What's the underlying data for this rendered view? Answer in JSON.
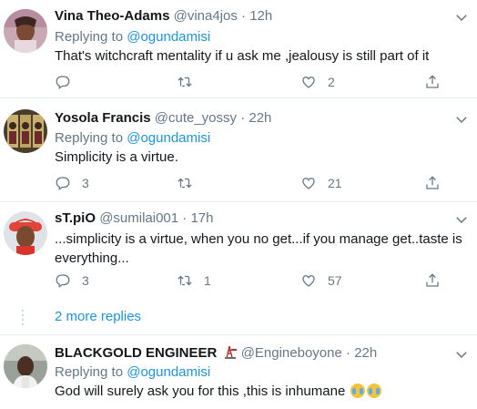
{
  "tweets": [
    {
      "name": "Vina Theo-Adams",
      "handle": "@vina4jos",
      "separator": "·",
      "time": "12h",
      "replying_prefix": "Replying to",
      "replying_to": "@ogundamisi",
      "text": "That's witchcraft mentality if u ask me ,jealousy is still part of it",
      "replies": "",
      "retweets": "",
      "likes": "2"
    },
    {
      "name": "Yosola Francis",
      "handle": "@cute_yossy",
      "separator": "·",
      "time": "22h",
      "replying_prefix": "Replying to",
      "replying_to": "@ogundamisi",
      "text": "Simplicity is a virtue.",
      "replies": "3",
      "retweets": "",
      "likes": "21"
    },
    {
      "name": "sT.piO",
      "handle": "@sumilai001",
      "separator": "·",
      "time": "17h",
      "text": "...simplicity is a virtue, when you no get...if you manage get..taste is everything...",
      "replies": "3",
      "retweets": "1",
      "likes": "57"
    },
    {
      "name": "BLACKGOLD ENGINEER",
      "handle": "@Engineboyone",
      "separator": "·",
      "time": "22h",
      "replying_prefix": "Replying to",
      "replying_to": "@ogundamisi",
      "text": "God will surely ask you for this ,this is inhumane"
    }
  ],
  "more_replies": "2 more replies",
  "icons": {
    "reply": "reply-icon",
    "retweet": "retweet-icon",
    "like": "heart-icon",
    "share": "share-icon",
    "menu": "chevron-down-icon",
    "badge": "oil-rig-icon",
    "emoji": "loudly-crying-face-icon"
  },
  "colors": {
    "link": "#1b95e0",
    "secondary_text": "#657786",
    "divider": "#e6ecf0"
  }
}
